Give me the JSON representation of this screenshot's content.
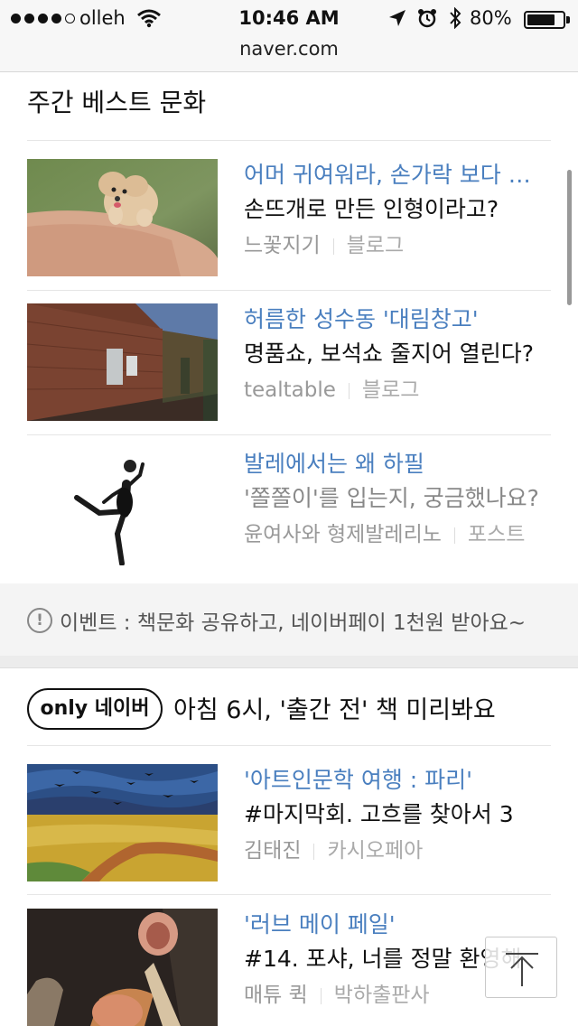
{
  "status": {
    "carrier": "olleh",
    "time": "10:46 AM",
    "battery": "80%",
    "battery_level": 0.8,
    "url": "naver.com"
  },
  "section1": {
    "title": "주간 베스트 문화",
    "items": [
      {
        "title": "어머 귀여워라, 손가락 보다 …",
        "desc": "손뜨개로 만든 인형이라고?",
        "author": "느꽃지기",
        "source": "블로그"
      },
      {
        "title": "허름한 성수동 '대림창고'",
        "desc": "명품쇼, 보석쇼 줄지어 열린다?",
        "author": "tealtable",
        "source": "블로그"
      },
      {
        "title": "발레에서는 왜 하필",
        "desc": "'쫄쫄이'를 입는지, 궁금했나요?",
        "author": "윤여사와 형제발레리노",
        "source": "포스트"
      }
    ]
  },
  "event": {
    "icon_glyph": "!",
    "text": "이벤트 : 책문화 공유하고, 네이버페이 1천원 받아요~"
  },
  "section2": {
    "badge": "only 네이버",
    "title": "아침 6시, '출간 전' 책 미리봐요",
    "items": [
      {
        "title": "'아트인문학 여행 : 파리'",
        "desc": "#마지막회. 고흐를 찾아서 3",
        "author": "김태진",
        "source": "카시오페아"
      },
      {
        "title": "'러브 메이 페일'",
        "desc": "#14. 포샤, 너를 정말 환영해",
        "author": "매튜 퀵",
        "source": "박하출판사"
      }
    ]
  },
  "colors": {
    "link_blue": "#4a7fbf",
    "meta_gray": "#999999"
  },
  "icons": {
    "top_button": "arrow-up-icon"
  }
}
